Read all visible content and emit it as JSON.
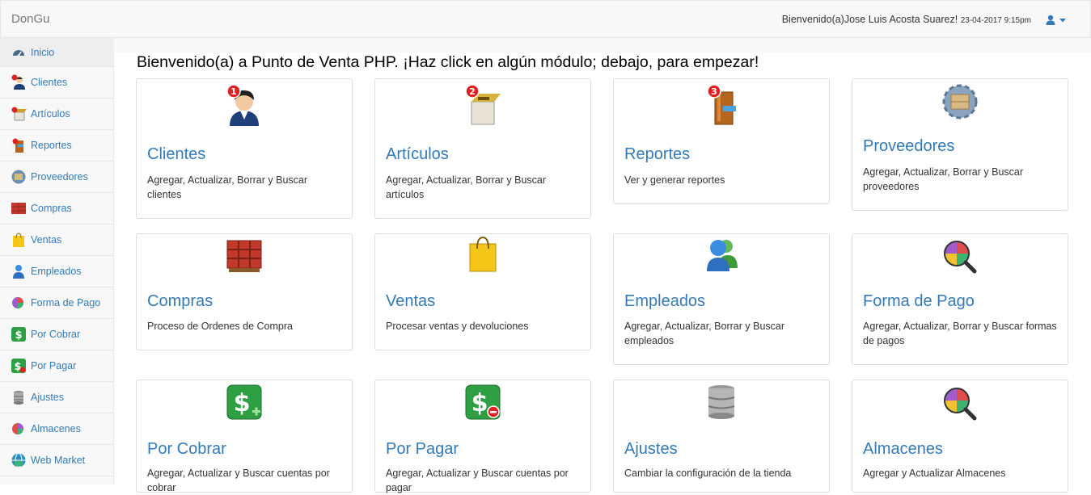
{
  "app": {
    "brand": "DonGu"
  },
  "header": {
    "welcome": "Bienvenido(a)Jose Luis Acosta Suarez!",
    "datetime": "23-04-2017 9:15pm",
    "user_icon": "user-icon"
  },
  "sidebar": {
    "items": [
      {
        "label": "Inicio",
        "icon": "dashboard-icon"
      },
      {
        "label": "Clientes",
        "icon": "customers-icon"
      },
      {
        "label": "Artículos",
        "icon": "items-icon"
      },
      {
        "label": "Reportes",
        "icon": "reports-icon"
      },
      {
        "label": "Proveedores",
        "icon": "suppliers-icon"
      },
      {
        "label": "Compras",
        "icon": "purchases-icon"
      },
      {
        "label": "Ventas",
        "icon": "sales-icon"
      },
      {
        "label": "Empleados",
        "icon": "employees-icon"
      },
      {
        "label": "Forma de Pago",
        "icon": "payment-methods-icon"
      },
      {
        "label": "Por Cobrar",
        "icon": "receivables-icon"
      },
      {
        "label": "Por Pagar",
        "icon": "payables-icon"
      },
      {
        "label": "Ajustes",
        "icon": "settings-icon"
      },
      {
        "label": "Almacenes",
        "icon": "warehouses-icon"
      },
      {
        "label": "Web Market",
        "icon": "web-market-icon"
      }
    ]
  },
  "main": {
    "title": "Bienvenido(a) a Punto de Venta PHP. ¡Haz click en algún módulo; debajo, para empezar!",
    "modules": [
      {
        "title": "Clientes",
        "desc": "Agregar, Actualizar, Borrar y Buscar clientes",
        "icon": "customers-icon",
        "badge": "1"
      },
      {
        "title": "Artículos",
        "desc": "Agregar, Actualizar, Borrar y Buscar artículos",
        "icon": "items-icon",
        "badge": "2"
      },
      {
        "title": "Reportes",
        "desc": "Ver y generar reportes",
        "icon": "reports-icon",
        "badge": "3"
      },
      {
        "title": "Proveedores",
        "desc": "Agregar, Actualizar, Borrar y Buscar proveedores",
        "icon": "suppliers-icon"
      },
      {
        "title": "Compras",
        "desc": "Proceso de Ordenes de Compra",
        "icon": "purchases-icon"
      },
      {
        "title": "Ventas",
        "desc": "Procesar ventas y devoluciones",
        "icon": "sales-icon"
      },
      {
        "title": "Empleados",
        "desc": "Agregar, Actualizar, Borrar y Buscar empleados",
        "icon": "employees-icon"
      },
      {
        "title": "Forma de Pago",
        "desc": "Agregar, Actualizar, Borrar y Buscar formas de pagos",
        "icon": "payment-methods-icon"
      },
      {
        "title": "Por Cobrar",
        "desc": "Agregar, Actualizar y Buscar cuentas por cobrar",
        "icon": "receivables-icon"
      },
      {
        "title": "Por Pagar",
        "desc": "Agregar, Actualizar y Buscar cuentas por pagar",
        "icon": "payables-icon"
      },
      {
        "title": "Ajustes",
        "desc": "Cambiar la configuración de la tienda",
        "icon": "settings-icon"
      },
      {
        "title": "Almacenes",
        "desc": "Agregar y Actualizar Almacenes",
        "icon": "warehouses-icon"
      }
    ]
  },
  "colors": {
    "link": "#337ab7",
    "navbar_bg": "#f8f8f8",
    "border": "#dddddd"
  }
}
